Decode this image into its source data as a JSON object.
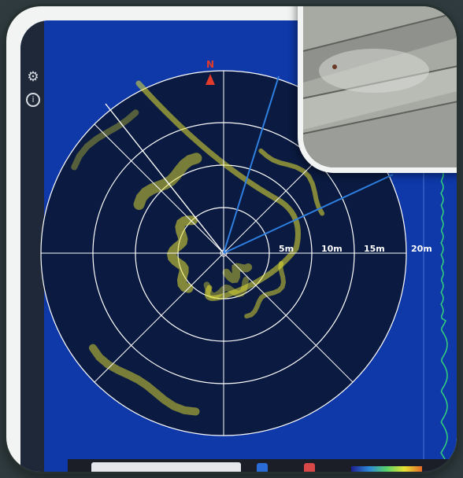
{
  "app": {
    "compass_label": "N",
    "range_labels": [
      "5m",
      "10m",
      "15m",
      "20m"
    ]
  },
  "sidebar": {
    "icons": [
      "settings-gear-icon",
      "info-icon"
    ]
  },
  "colors": {
    "screen_background": "#0f38a8",
    "sonar_background": "#0a1a40",
    "ring_color": "#ffffff",
    "echo_color": "#e6e234",
    "heading_beam": "#2f7fe0",
    "compass_marker": "#e23b2b",
    "profile_trace": "#33d47a"
  },
  "taskbar": {
    "search_placeholder": "",
    "legend_gradient": [
      "#1d1f8f",
      "#2d86d9",
      "#58d26a",
      "#e6e234",
      "#e46b28"
    ]
  }
}
